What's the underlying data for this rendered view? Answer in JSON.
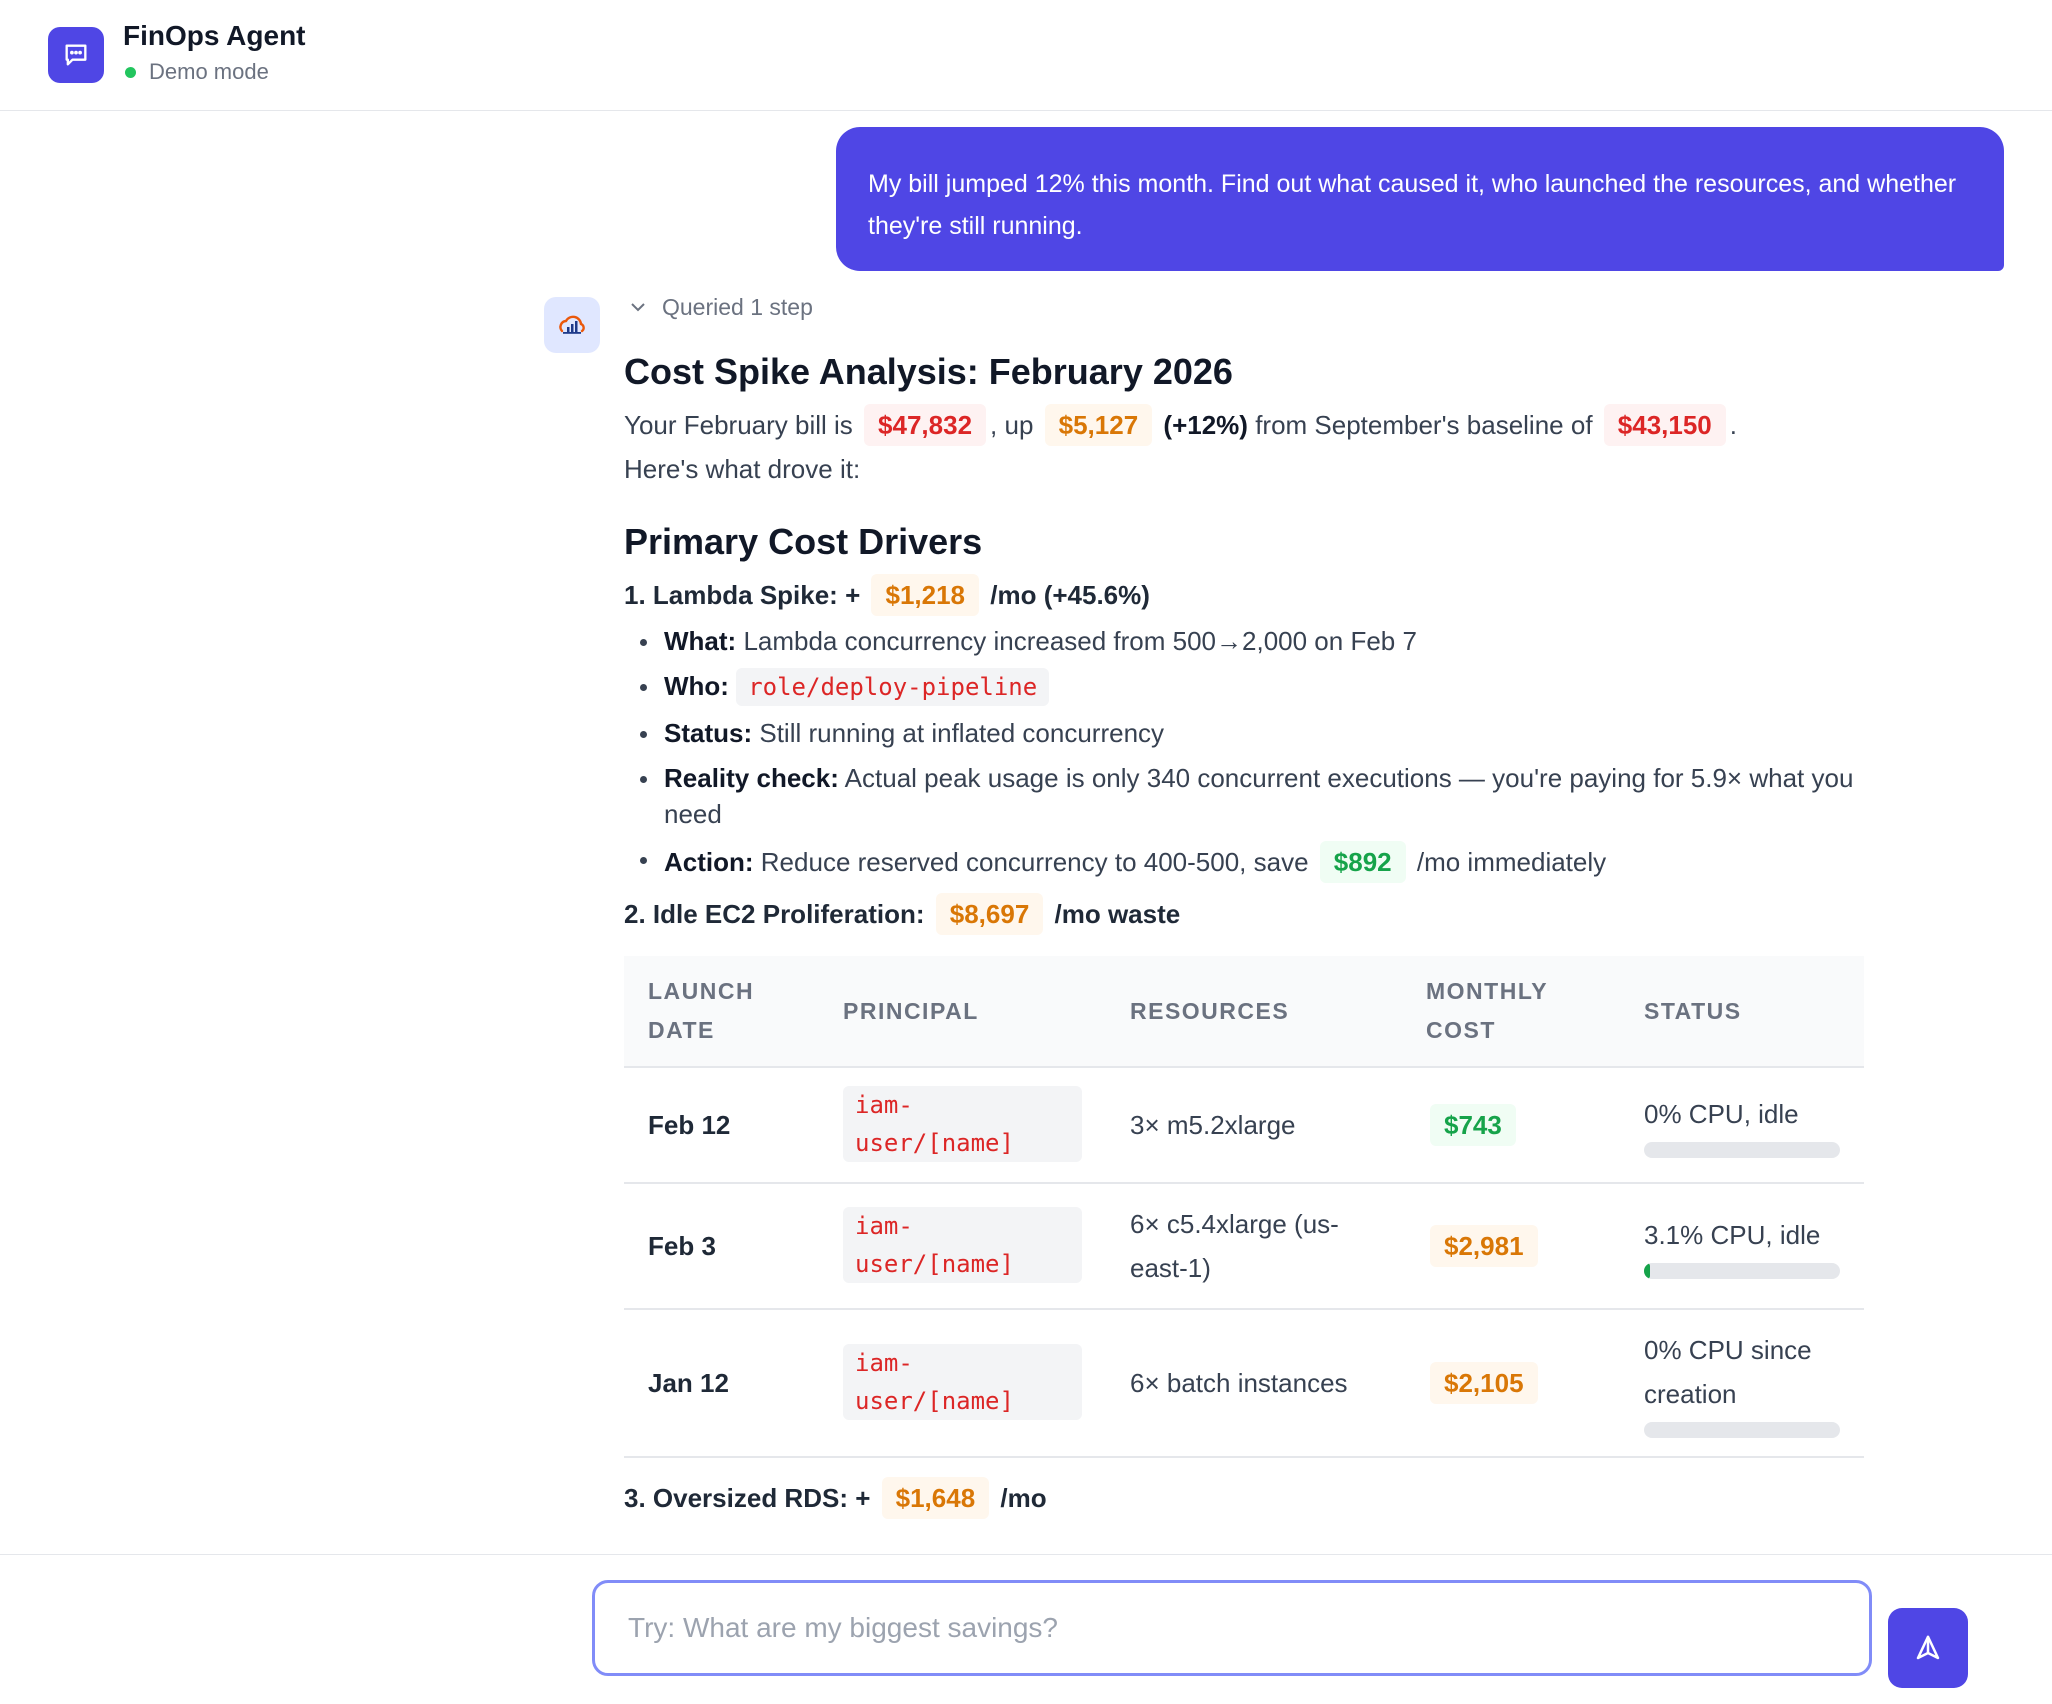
{
  "app": {
    "title": "FinOps Agent",
    "mode": "Demo mode"
  },
  "user_message": "My bill jumped 12% this month. Find out what caused it, who launched the resources, and whether they're still running.",
  "assistant": {
    "steps_label": "Queried 1 step",
    "title": "Cost Spike Analysis: February 2026",
    "intro": {
      "t1": "Your February bill is",
      "bill": "$47,832",
      "t2": ", up",
      "increase": "$5,127",
      "pct": "(+12%)",
      "t3": "from September's baseline of",
      "baseline": "$43,150",
      "t4": ".",
      "t5": "Here's what drove it:"
    },
    "drivers_heading": "Primary Cost Drivers",
    "driver1": {
      "label": "1. Lambda Spike: +",
      "amount": "$1,218",
      "suffix": "/mo (+45.6%)",
      "what_label": "What:",
      "what": "Lambda concurrency increased from 500→2,000 on Feb 7",
      "who_label": "Who:",
      "who": "role/deploy-pipeline",
      "status_label": "Status:",
      "status": "Still running at inflated concurrency",
      "reality_label": "Reality check:",
      "reality": "Actual peak usage is only 340 concurrent executions — you're paying for 5.9× what you need",
      "action_label": "Action:",
      "action": "Reduce reserved concurrency to 400-500, save",
      "action_amount": "$892",
      "action_suffix": "/mo immediately"
    },
    "driver2": {
      "label": "2. Idle EC2 Proliferation:",
      "amount": "$8,697",
      "suffix": "/mo waste"
    },
    "table": {
      "headers": [
        "LAUNCH DATE",
        "PRINCIPAL",
        "RESOURCES",
        "MONTHLY COST",
        "STATUS"
      ],
      "rows": [
        {
          "date": "Feb 12",
          "principal": "iam-user/[name]",
          "resources": "3× m5.2xlarge",
          "cost": "$743",
          "status": "0% CPU, idle",
          "cpu": 0
        },
        {
          "date": "Feb 3",
          "principal": "iam-user/[name]",
          "resources": "6× c5.4xlarge (us-east-1)",
          "cost": "$2,981",
          "status": "3.1% CPU, idle",
          "cpu": 3.1
        },
        {
          "date": "Jan 12",
          "principal": "iam-user/[name]",
          "resources": "6× batch instances",
          "cost": "$2,105",
          "status": "0% CPU since creation",
          "cpu": 0
        }
      ]
    },
    "driver3": {
      "label": "3. Oversized RDS: +",
      "amount": "$1,648",
      "suffix": "/mo"
    }
  },
  "composer": {
    "placeholder": "Try: What are my biggest savings?",
    "value": ""
  },
  "icons": {
    "app": "chat-icon",
    "assistant": "chart-cloud-icon",
    "send": "send-icon",
    "steps": "chevron-down-icon"
  },
  "colors": {
    "accent": "#4f46e5",
    "red": "#dc2626",
    "amber": "#d97706",
    "green": "#16a34a"
  }
}
